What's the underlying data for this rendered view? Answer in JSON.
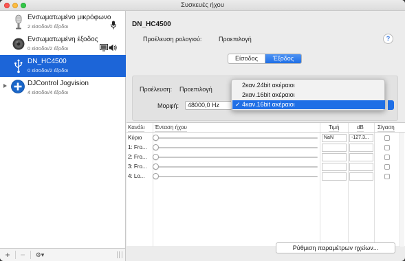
{
  "window": {
    "title": "Συσκευές ήχου"
  },
  "sidebar": {
    "devices": [
      {
        "name": "Ενσωματωμένο μικρόφωνο",
        "sub": "2 είσοδοι/0 έξοδοι",
        "icon": "microphone-icon",
        "selected": false
      },
      {
        "name": "Ενσωματωμένη έξοδος",
        "sub": "0 είσοδοι/2 έξοδοι",
        "icon": "speaker-icon",
        "selected": false
      },
      {
        "name": "DN_HC4500",
        "sub": "0 είσοδοι/2 έξοδοι",
        "icon": "usb-icon",
        "selected": true
      },
      {
        "name": "DJControl Jogvision",
        "sub": "4 είσοδοι/4 έξοδοι",
        "icon": "aggregate-plus-icon",
        "selected": false
      }
    ],
    "footer": {
      "add": "+",
      "remove": "−",
      "gear": "⚙▾"
    }
  },
  "main": {
    "device_title": "DN_HC4500",
    "clock_label": "Προέλευση ρολογιού:",
    "clock_value": "Προεπιλογή",
    "help": "?",
    "tabs": [
      {
        "label": "Είσοδος",
        "active": false
      },
      {
        "label": "Έξοδος",
        "active": true
      }
    ],
    "source_label": "Προέλευση:",
    "source_value": "Προεπιλογή",
    "format_label": "Μορφή:",
    "format_rate": "48000,0 Hz",
    "format_options": [
      {
        "label": "2καν.24bit ακέραιοι",
        "selected": false
      },
      {
        "label": "2καν.16bit ακέραιοι",
        "selected": false
      },
      {
        "label": "4καν.16bit ακέραιοι",
        "selected": true
      }
    ],
    "check": "✓",
    "table": {
      "headers": {
        "channel": "Κανάλι",
        "volume": "Ένταση ήχου",
        "value": "Τιμή",
        "db": "dB",
        "mute": "Σίγαση"
      },
      "rows": [
        {
          "label": "Κύριο",
          "value": "NaN",
          "db": "-127.3..."
        },
        {
          "label": "1: Fro...",
          "value": "",
          "db": ""
        },
        {
          "label": "2: Fro...",
          "value": "",
          "db": ""
        },
        {
          "label": "3: Fro...",
          "value": "",
          "db": ""
        },
        {
          "label": "4: Lo...",
          "value": "",
          "db": ""
        }
      ]
    },
    "configure_button": "Ρύθμιση παραμέτρων ηχείων..."
  }
}
